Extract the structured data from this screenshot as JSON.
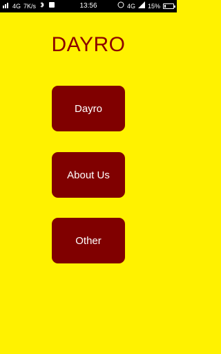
{
  "status_bar": {
    "left_items": [
      "4G",
      "7K/s"
    ],
    "time": "13:56",
    "right_items": [
      "4G",
      "15%"
    ]
  },
  "app": {
    "title": "DAYRO"
  },
  "buttons": [
    {
      "label": "Dayro"
    },
    {
      "label": "About Us"
    },
    {
      "label": "Other"
    }
  ],
  "colors": {
    "background": "#fff200",
    "title": "#8b0000",
    "button_bg": "#800000",
    "button_text": "#ffffff"
  }
}
